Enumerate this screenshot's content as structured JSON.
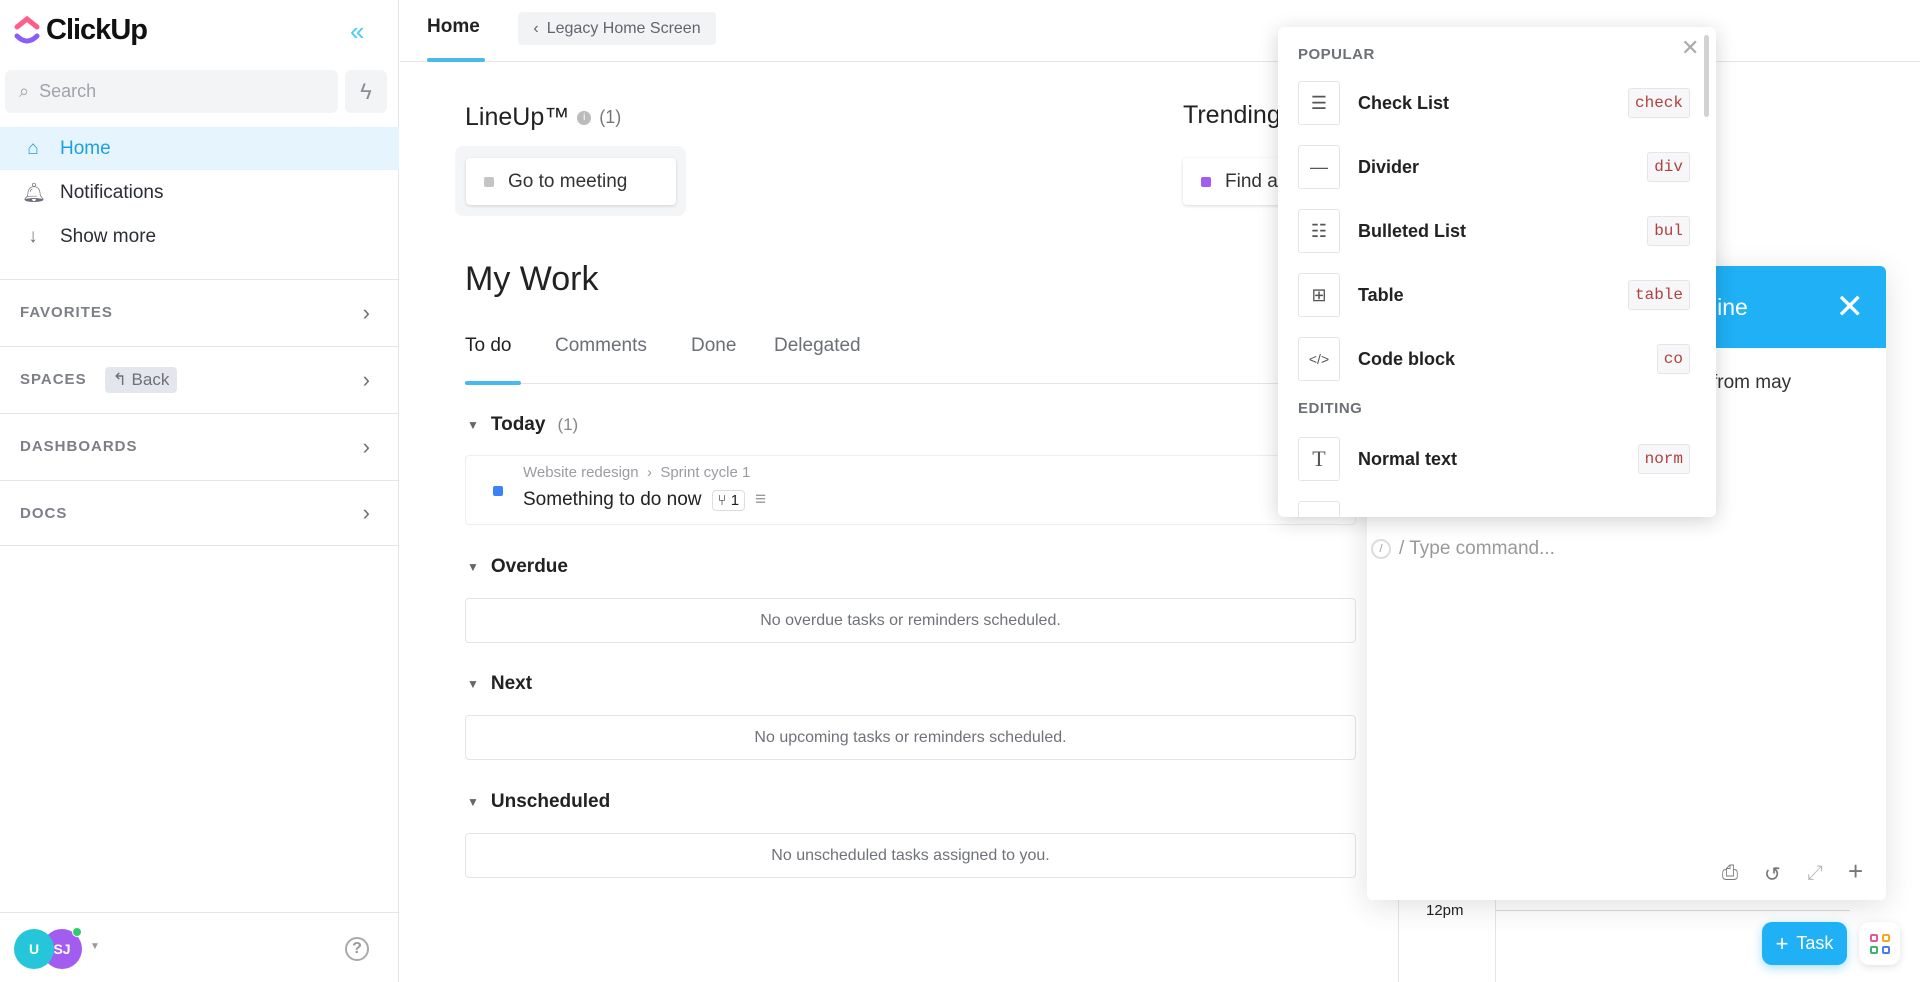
{
  "app": {
    "name": "ClickUp"
  },
  "sidebar": {
    "search_placeholder": "Search",
    "nav": [
      {
        "label": "Home",
        "icon": "home-icon"
      },
      {
        "label": "Notifications",
        "icon": "bell-icon"
      },
      {
        "label": "Show more",
        "icon": "arrow-down-icon"
      }
    ],
    "sections": [
      {
        "label": "FAVORITES"
      },
      {
        "label": "SPACES",
        "extra": "Back"
      },
      {
        "label": "DASHBOARDS"
      },
      {
        "label": "DOCS"
      }
    ],
    "avatars": [
      {
        "initials": "U",
        "color": "#26c6da"
      },
      {
        "initials": "SJ",
        "color": "#a35cf0"
      }
    ]
  },
  "header": {
    "tab": "Home",
    "legacy": "Legacy Home Screen"
  },
  "lineup": {
    "title": "LineUp™",
    "count": "(1)",
    "card": "Go to meeting"
  },
  "trending": {
    "title": "Trending",
    "card": "Find a"
  },
  "mywork": {
    "title": "My Work",
    "tabs": [
      "To do",
      "Comments",
      "Done",
      "Delegated"
    ],
    "groups": [
      {
        "label": "Today",
        "count": "(1)"
      },
      {
        "label": "Overdue",
        "empty": "No overdue tasks or reminders scheduled."
      },
      {
        "label": "Next",
        "empty": "No upcoming tasks or reminders scheduled."
      },
      {
        "label": "Unscheduled",
        "empty": "No unscheduled tasks assigned to you."
      }
    ],
    "task": {
      "path1": "Website redesign",
      "path2": "Sprint cycle 1",
      "name": "Something to do now",
      "subtasks": "1",
      "status_color": "#3b82f6"
    }
  },
  "popup": {
    "sections": [
      "POPULAR",
      "EDITING"
    ],
    "items": [
      {
        "label": "Check List",
        "shortcut": "check",
        "icon": "checklist-icon"
      },
      {
        "label": "Divider",
        "shortcut": "div",
        "icon": "divider-icon"
      },
      {
        "label": "Bulleted List",
        "shortcut": "bul",
        "icon": "bulleted-list-icon"
      },
      {
        "label": "Table",
        "shortcut": "table",
        "icon": "table-icon"
      },
      {
        "label": "Code block",
        "shortcut": "co",
        "icon": "code-icon"
      },
      {
        "label": "Normal text",
        "shortcut": "norm",
        "icon": "text-icon"
      }
    ]
  },
  "notepad": {
    "title_fragment": "line",
    "body_fragment": "from may",
    "command_placeholder": "/ Type command..."
  },
  "calendar": {
    "time": "12pm"
  },
  "fab": {
    "task": "Task"
  },
  "colors": {
    "accent": "#1fb0f5",
    "active_bg": "#e6f5fd"
  }
}
